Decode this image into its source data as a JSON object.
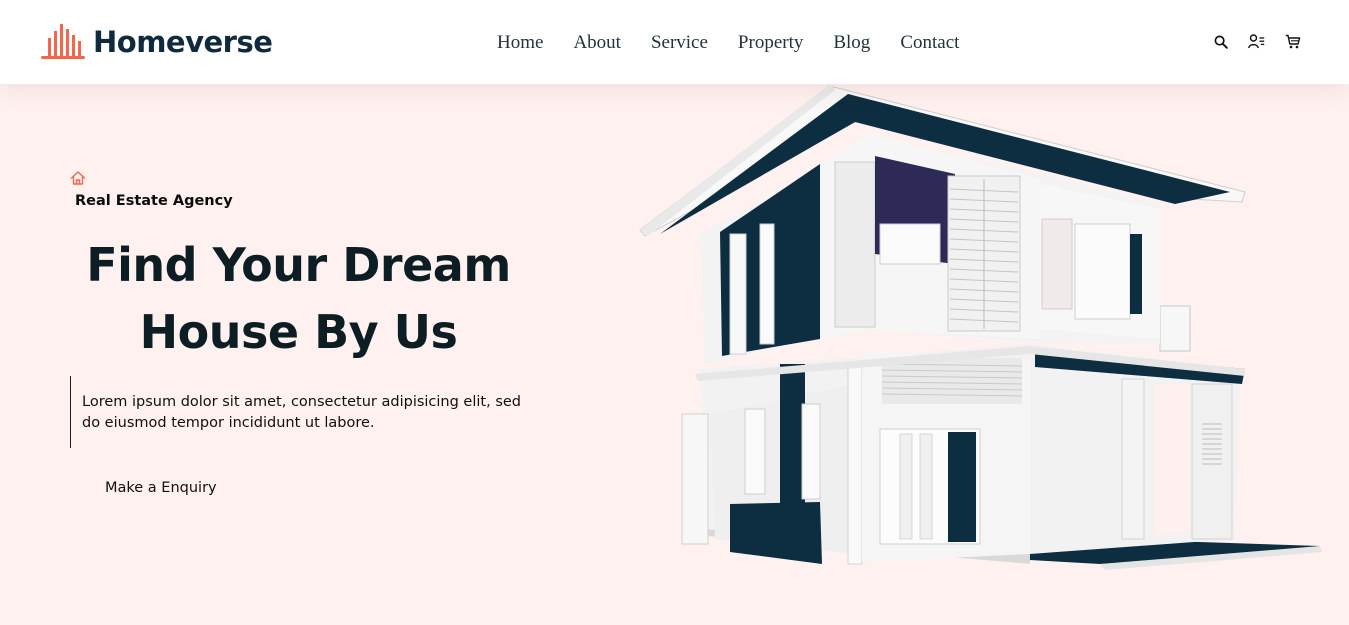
{
  "brand": {
    "name": "Homeverse",
    "logo_icon": "buildings-bars-icon",
    "accent": "#f2664b"
  },
  "nav": {
    "items": [
      "Home",
      "About",
      "Service",
      "Property",
      "Blog",
      "Contact"
    ]
  },
  "header_tools": {
    "icons": [
      "search-icon",
      "user-icon",
      "cart-icon"
    ]
  },
  "hero": {
    "tag_icon": "home-outline-icon",
    "subtitle": "Real Estate Agency",
    "title_line1": "Find Your Dream",
    "title_line2": "House By Us",
    "description": "Lorem ipsum dolor sit amet, consectetur adipisicing elit, sed do eiusmod tempor incididunt ut labore.",
    "cta_label": "Make a Enquiry"
  },
  "colors": {
    "background": "#fff1f0",
    "dark_navy": "#0d2d40",
    "text_dark": "#0c1e23"
  }
}
